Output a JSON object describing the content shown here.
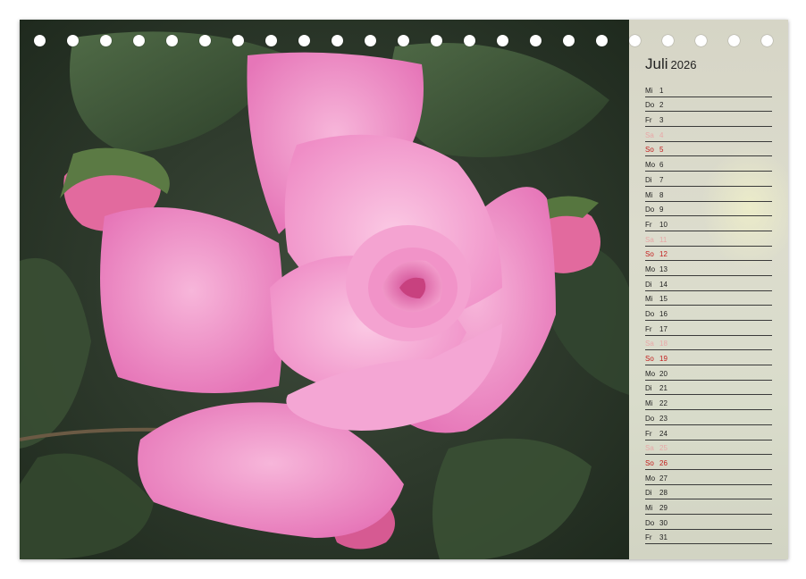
{
  "calendar": {
    "month": "Juli",
    "year": "2026",
    "days": [
      {
        "wd": "Mi",
        "d": "1",
        "type": "weekday"
      },
      {
        "wd": "Do",
        "d": "2",
        "type": "weekday"
      },
      {
        "wd": "Fr",
        "d": "3",
        "type": "weekday"
      },
      {
        "wd": "Sa",
        "d": "4",
        "type": "sat"
      },
      {
        "wd": "So",
        "d": "5",
        "type": "sun"
      },
      {
        "wd": "Mo",
        "d": "6",
        "type": "weekday"
      },
      {
        "wd": "Di",
        "d": "7",
        "type": "weekday"
      },
      {
        "wd": "Mi",
        "d": "8",
        "type": "weekday"
      },
      {
        "wd": "Do",
        "d": "9",
        "type": "weekday"
      },
      {
        "wd": "Fr",
        "d": "10",
        "type": "weekday"
      },
      {
        "wd": "Sa",
        "d": "11",
        "type": "sat"
      },
      {
        "wd": "So",
        "d": "12",
        "type": "sun"
      },
      {
        "wd": "Mo",
        "d": "13",
        "type": "weekday"
      },
      {
        "wd": "Di",
        "d": "14",
        "type": "weekday"
      },
      {
        "wd": "Mi",
        "d": "15",
        "type": "weekday"
      },
      {
        "wd": "Do",
        "d": "16",
        "type": "weekday"
      },
      {
        "wd": "Fr",
        "d": "17",
        "type": "weekday"
      },
      {
        "wd": "Sa",
        "d": "18",
        "type": "sat"
      },
      {
        "wd": "So",
        "d": "19",
        "type": "sun"
      },
      {
        "wd": "Mo",
        "d": "20",
        "type": "weekday"
      },
      {
        "wd": "Di",
        "d": "21",
        "type": "weekday"
      },
      {
        "wd": "Mi",
        "d": "22",
        "type": "weekday"
      },
      {
        "wd": "Do",
        "d": "23",
        "type": "weekday"
      },
      {
        "wd": "Fr",
        "d": "24",
        "type": "weekday"
      },
      {
        "wd": "Sa",
        "d": "25",
        "type": "sat"
      },
      {
        "wd": "So",
        "d": "26",
        "type": "sun"
      },
      {
        "wd": "Mo",
        "d": "27",
        "type": "weekday"
      },
      {
        "wd": "Di",
        "d": "28",
        "type": "weekday"
      },
      {
        "wd": "Mi",
        "d": "29",
        "type": "weekday"
      },
      {
        "wd": "Do",
        "d": "30",
        "type": "weekday"
      },
      {
        "wd": "Fr",
        "d": "31",
        "type": "weekday"
      }
    ]
  },
  "colors": {
    "sunday": "#c31d1d",
    "saturday": "#e8a7a7",
    "rose": "#f29ccb",
    "leaf": "#3f5a37"
  },
  "photo": {
    "subject": "pink-rose-icon"
  }
}
